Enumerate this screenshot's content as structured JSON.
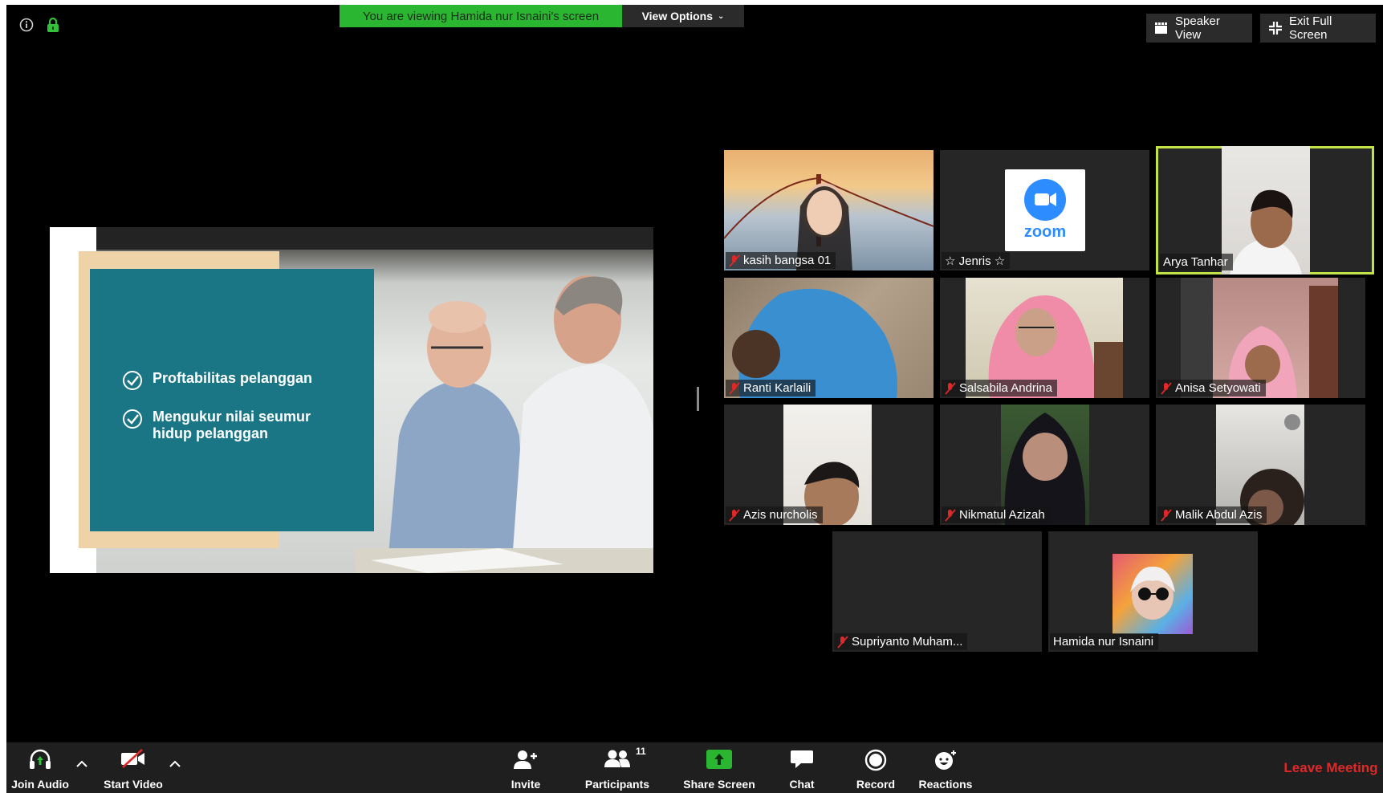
{
  "banner": {
    "viewing_text": "You are viewing Hamida nur Isnaini's screen",
    "view_options_label": "View Options"
  },
  "top_right": {
    "speaker_view_label": "Speaker View",
    "exit_full_screen_label": "Exit Full Screen"
  },
  "slide": {
    "bullets": [
      "Proftabilitas pelanggan",
      "Mengukur nilai seumur hidup pelanggan"
    ]
  },
  "participants": [
    {
      "name": "kasih bangsa 01",
      "muted": true
    },
    {
      "name": "☆ Jenris ☆",
      "muted": false,
      "placeholder_logo": "zoom"
    },
    {
      "name": "Arya Tanhar",
      "muted": false,
      "active_speaker": true
    },
    {
      "name": "Ranti Karlaili",
      "muted": true
    },
    {
      "name": "Salsabila Andrina",
      "muted": true
    },
    {
      "name": "Anisa Setyowati",
      "muted": true
    },
    {
      "name": "Azis nurcholis",
      "muted": true
    },
    {
      "name": "Nikmatul Azizah",
      "muted": true
    },
    {
      "name": "Malik Abdul Azis",
      "muted": true
    },
    {
      "name": "Supriyanto Muham...",
      "muted": true
    },
    {
      "name": "Hamida nur Isnaini",
      "muted": false
    }
  ],
  "toolbar": {
    "join_audio": "Join Audio",
    "start_video": "Start Video",
    "invite": "Invite",
    "participants": "Participants",
    "participants_count": "11",
    "share_screen": "Share Screen",
    "chat": "Chat",
    "record": "Record",
    "reactions": "Reactions",
    "leave_meeting": "Leave Meeting"
  },
  "colors": {
    "banner_green": "#2bb632",
    "active_speaker_border": "#c2e347",
    "leave_red": "#e02828",
    "slide_teal": "#1a7585",
    "share_green": "#2bb632"
  }
}
